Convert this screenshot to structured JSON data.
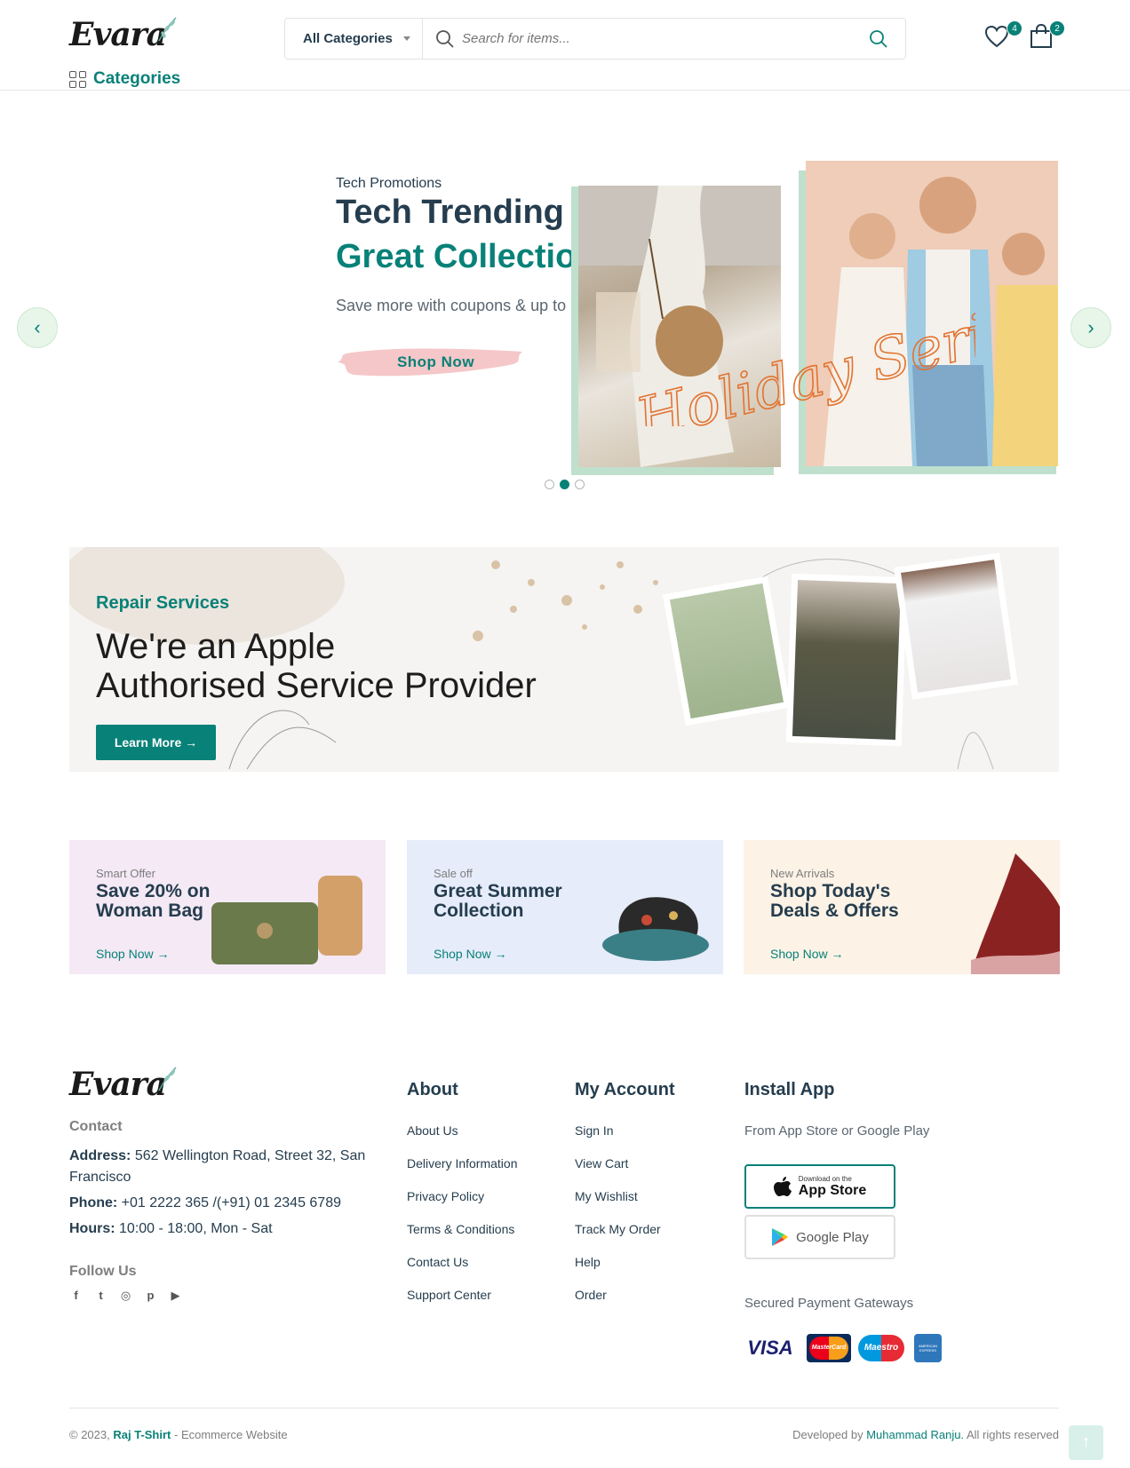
{
  "brand": {
    "logo_text": "Evara"
  },
  "header": {
    "category_select": "All Categories",
    "search_placeholder": "Search for items...",
    "wishlist_count": "4",
    "cart_count": "2",
    "categories_label": "Categories"
  },
  "hero": {
    "subtitle": "Tech Promotions",
    "title_line1": "Tech Trending",
    "title_line2": "Great Collection",
    "description": "Save more with coupons & up to 20% off",
    "button": "Shop Now",
    "script_text": "Holiday Series",
    "slides": 3,
    "active_slide": 2
  },
  "service": {
    "subtitle": "Repair Services",
    "title": "We're an Apple\nAuthorised Service Provider",
    "button": "Learn More →"
  },
  "promos": [
    {
      "small": "Smart Offer",
      "title": "Save 20% on\nWoman Bag",
      "link": "Shop Now →",
      "bg": "#f4e9f5"
    },
    {
      "small": "Sale off",
      "title": "Great Summer\nCollection",
      "link": "Shop Now →",
      "bg": "#e6ecfa"
    },
    {
      "small": "New Arrivals",
      "title": "Shop Today's\nDeals & Offers",
      "link": "Shop Now →",
      "bg": "#fcf2e6"
    }
  ],
  "footer": {
    "contact_label": "Contact",
    "address_label": "Address:",
    "address": "562 Wellington Road, Street 32, San Francisco",
    "phone_label": "Phone:",
    "phone": "+01 2222 365 /(+91) 01 2345 6789",
    "hours_label": "Hours:",
    "hours": "10:00 - 18:00, Mon - Sat",
    "follow_label": "Follow Us",
    "social_icons": [
      "facebook-icon",
      "twitter-icon",
      "instagram-icon",
      "pinterest-icon",
      "youtube-icon"
    ],
    "about": {
      "heading": "About",
      "links": [
        "About Us",
        "Delivery Information",
        "Privacy Policy",
        "Terms & Conditions",
        "Contact Us",
        "Support Center"
      ]
    },
    "account": {
      "heading": "My Account",
      "links": [
        "Sign In",
        "View Cart",
        "My Wishlist",
        "Track My Order",
        "Help",
        "Order"
      ]
    },
    "app": {
      "heading": "Install App",
      "text": "From App Store or Google Play",
      "appstore_small": "Download on the",
      "appstore_big": "App Store",
      "googleplay": "Google Play",
      "payments_label": "Secured Payment Gateways",
      "payments": [
        "VISA",
        "MasterCard",
        "Maestro",
        "AMERICAN EXPRESS"
      ]
    },
    "copyright_prefix": "© 2023,",
    "copyright_brand": "Raj T-Shirt",
    "copyright_suffix": "- Ecommerce Website",
    "dev_prefix": "Developed by",
    "dev_name": "Muhammad Ranju.",
    "dev_suffix": "All rights reserved"
  },
  "colors": {
    "accent": "#088178",
    "text": "#253d4e",
    "muted": "#7e7e7e"
  }
}
